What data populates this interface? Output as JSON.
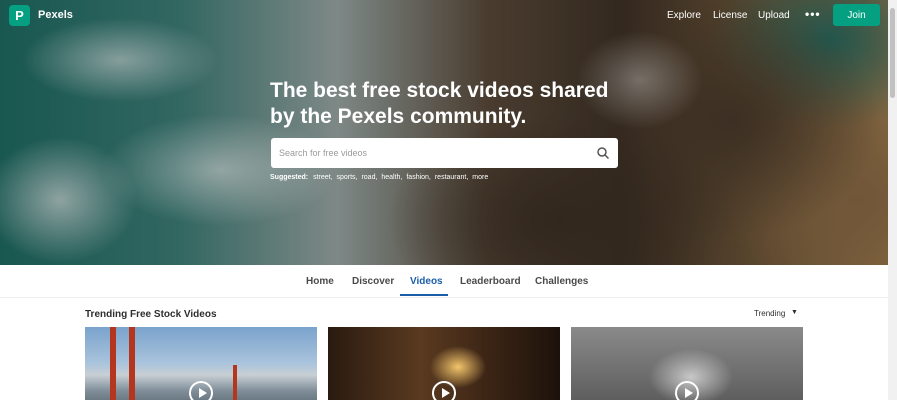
{
  "topnav": {
    "brand": "Pexels",
    "logo_letter": "P",
    "links": [
      "Explore",
      "License",
      "Upload"
    ],
    "more_label": "•••",
    "join_label": "Join"
  },
  "hero": {
    "headline": "The best free stock videos shared by the Pexels community.",
    "search_placeholder": "Search for free videos",
    "suggested_label": "Suggested:",
    "suggestions": [
      "street,",
      "sports,",
      "road,",
      "health,",
      "fashion,",
      "restaurant,",
      "more"
    ]
  },
  "tabs": [
    "Home",
    "Discover",
    "Videos",
    "Leaderboard",
    "Challenges"
  ],
  "active_tab": "Videos",
  "section": {
    "title": "Trending Free Stock Videos",
    "sort_label": "Trending",
    "sort_caret": "▼"
  },
  "colors": {
    "brand": "#05a081",
    "active_tab": "#1a5ea8"
  }
}
